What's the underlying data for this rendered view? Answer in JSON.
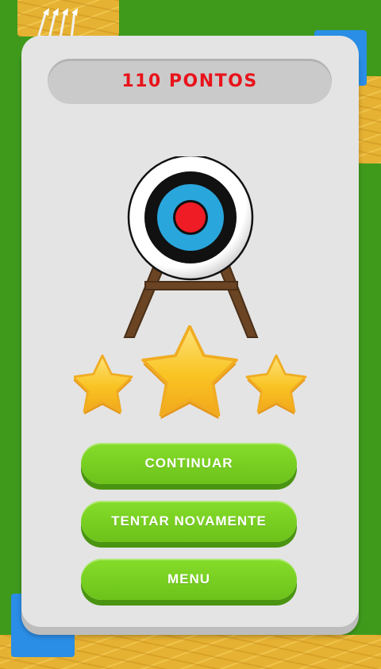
{
  "score": {
    "label": "110 PONTOS",
    "color": "#e8131b"
  },
  "rating": {
    "stars_earned": 3,
    "stars_total": 3
  },
  "buttons": {
    "continue_label": "CONTINUAR",
    "retry_label": "TENTAR NOVAMENTE",
    "menu_label": "MENU"
  },
  "icons": {
    "target": "archery-target-icon",
    "star": "star-icon",
    "arrows": "arrows-bundle-icon"
  },
  "colors": {
    "button_green": "#7ad122",
    "panel": "#e4e4e4",
    "star": "#f9c423",
    "grass": "#3f9a1c",
    "hay": "#e6b233"
  }
}
